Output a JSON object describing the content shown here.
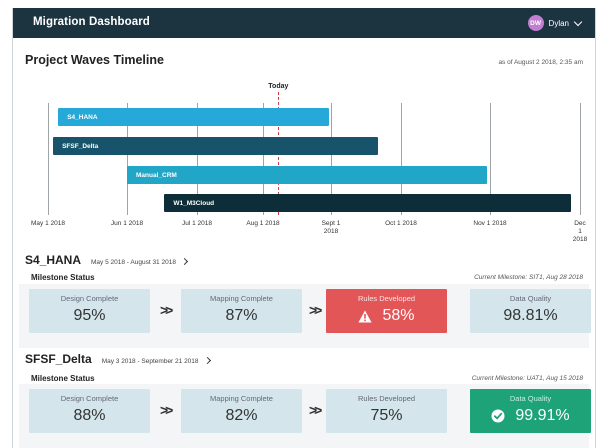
{
  "app": {
    "title": "Migration Dashboard",
    "user_initials": "DW",
    "user_name": "Dylan"
  },
  "timeline": {
    "title": "Project Waves Timeline",
    "as_of": "as of August 2 2018, 2:35 am",
    "today_label": "Today",
    "axis_labels": [
      "May 1 2018",
      "Jun 1 2018",
      "Jul 1 2018",
      "Aug 1 2018",
      "Sept 1\n2018",
      "Oct 1 2018",
      "Nov 1 2018",
      "Dec 1 2018"
    ],
    "waves": [
      {
        "name": "S4_HANA",
        "start": "2018-05-05",
        "end": "2018-08-31",
        "color": "#26a9d8"
      },
      {
        "name": "SFSF_Delta",
        "start": "2018-05-03",
        "end": "2018-09-21",
        "color": "#17546b"
      },
      {
        "name": "Manual_CRM",
        "start": "2018-06-01",
        "end": "2018-10-31",
        "color": "#22a6c7"
      },
      {
        "name": "W1_M3Cloud",
        "start": "2018-06-17",
        "end": "2018-11-28",
        "color": "#0d2e38"
      }
    ]
  },
  "projects": [
    {
      "name": "S4_HANA",
      "dates": "May 5 2018 - August 31 2018",
      "milestone_label": "Milestone Status",
      "current_prefix": "Current Milestone:",
      "current_value": "SIT1, Aug 28 2018",
      "milestones": [
        {
          "label": "Design Complete",
          "value": "95%",
          "status": "normal"
        },
        {
          "label": "Mapping Complete",
          "value": "87%",
          "status": "normal"
        },
        {
          "label": "Rules Developed",
          "value": "58%",
          "status": "alert"
        },
        {
          "label": "Data Quality",
          "value": "98.81%",
          "status": "normal"
        }
      ]
    },
    {
      "name": "SFSF_Delta",
      "dates": "May 3 2018 - September 21 2018",
      "milestone_label": "Milestone Status",
      "current_prefix": "Current Milestone:",
      "current_value": "UAT1, Aug 15 2018",
      "milestones": [
        {
          "label": "Design Complete",
          "value": "88%",
          "status": "normal"
        },
        {
          "label": "Mapping Complete",
          "value": "82%",
          "status": "normal"
        },
        {
          "label": "Rules Developed",
          "value": "75%",
          "status": "normal"
        },
        {
          "label": "Data Quality",
          "value": "99.91%",
          "status": "success"
        }
      ]
    }
  ],
  "colors": {
    "topbar": "#1c3440",
    "alert": "#e35658",
    "success": "#1ea277",
    "card": "#d4e6ec"
  }
}
